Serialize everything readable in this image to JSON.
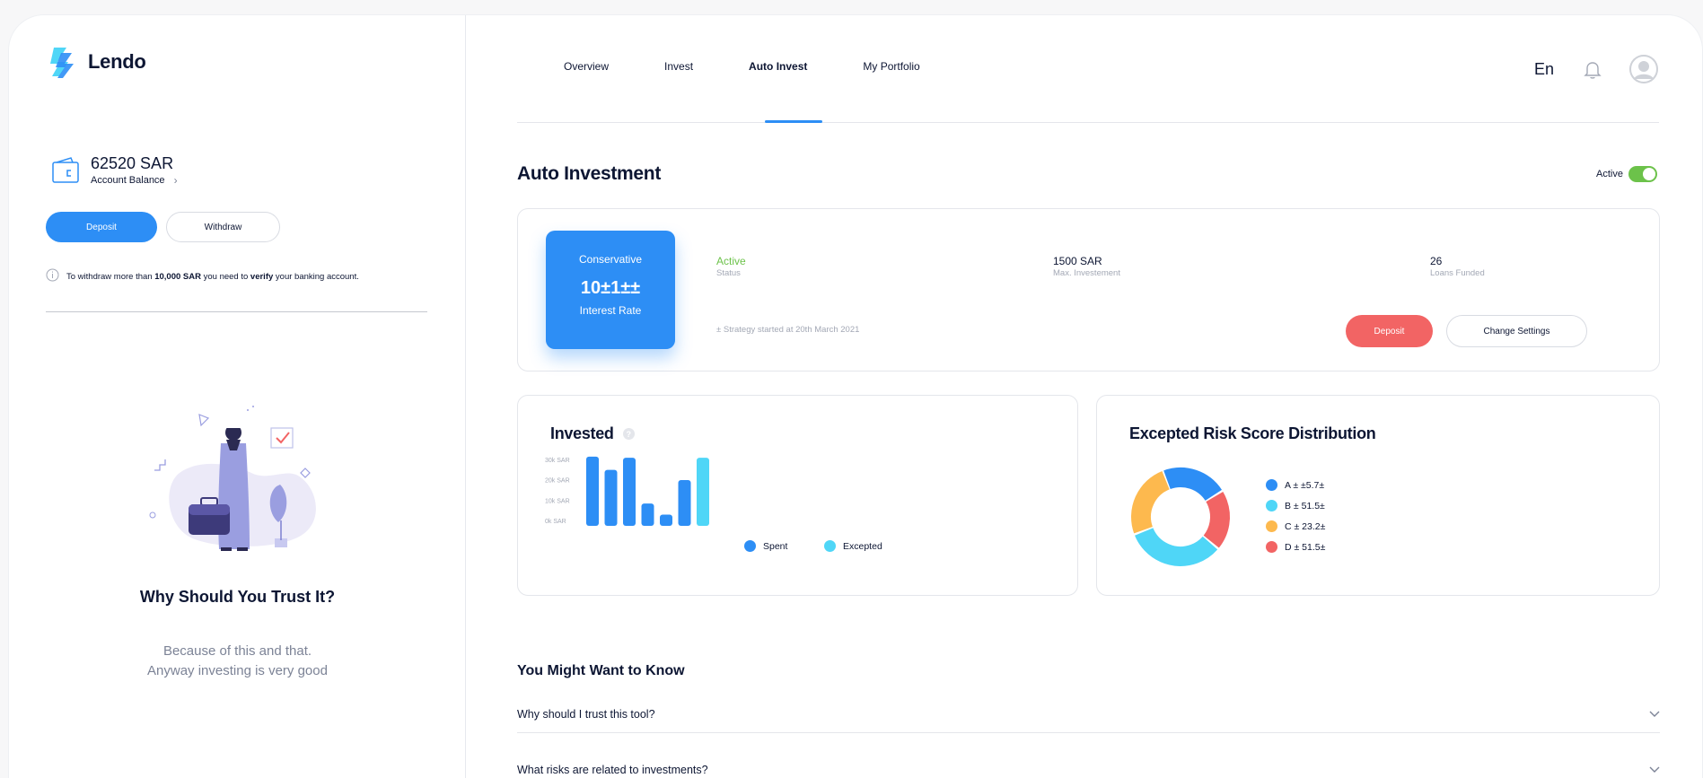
{
  "brand": {
    "name": "Lendo"
  },
  "account": {
    "balance": "62520 SAR",
    "balance_label": "Account Balance"
  },
  "actions": {
    "deposit": "Deposit",
    "withdraw": "Withdraw"
  },
  "notice": {
    "pre": "To withdraw more than ",
    "amount": "10,000 SAR",
    "mid": " you need to ",
    "verify": "verify",
    "post": " your banking account."
  },
  "trust": {
    "title": "Why Should You Trust It?",
    "line1": "Because of this and that.",
    "line2": "Anyway investing is very good"
  },
  "nav": {
    "items": [
      "Overview",
      "Invest",
      "Auto Invest",
      "My Portfolio"
    ],
    "active": "Auto Invest",
    "language": "En"
  },
  "auto": {
    "title": "Auto Investment",
    "toggle_label": "Active",
    "toggle_on": true,
    "strategy": {
      "name": "Conservative",
      "rate": "10±1±±",
      "rate_label": "Interest Rate"
    },
    "stats": [
      {
        "value": "Active",
        "label": "Status"
      },
      {
        "value": "1500 SAR",
        "label": "Max. Investement"
      },
      {
        "value": "26",
        "label": "Loans Funded"
      }
    ],
    "note": "± Strategy started at 20th March 2021",
    "deposit": "Deposit",
    "change_settings": "Change Settings"
  },
  "invested": {
    "title": "Invested",
    "help": "?"
  },
  "chart_data": [
    {
      "type": "bar",
      "title": "Invested",
      "y_ticks": [
        "30k SAR",
        "20k SAR",
        "10k SAR",
        "0k SAR"
      ],
      "ylim": [
        0,
        30000
      ],
      "series": [
        {
          "name": "Spent",
          "color": "#2d8ef5",
          "values": [
            34000,
            27500,
            33500,
            11000,
            5500,
            22500
          ]
        },
        {
          "name": "Excepted",
          "color": "#4fd6f7",
          "values": [
            0,
            0,
            0,
            0,
            0,
            0,
            33500
          ]
        }
      ],
      "bars": [
        {
          "series": "Spent",
          "value": 34000
        },
        {
          "series": "Spent",
          "value": 27500
        },
        {
          "series": "Spent",
          "value": 33500
        },
        {
          "series": "Spent",
          "value": 11000
        },
        {
          "series": "Spent",
          "value": 5500
        },
        {
          "series": "Spent",
          "value": 22500
        },
        {
          "series": "Excepted",
          "value": 33500
        }
      ],
      "legend": [
        "Spent",
        "Excepted"
      ]
    },
    {
      "type": "pie",
      "title": "Excepted Risk Score Distribution",
      "slices": [
        {
          "label": "A ± ±5.7±",
          "value": 22,
          "color": "#2d8ef5"
        },
        {
          "label": "D ± 51.5±",
          "value": 20,
          "color": "#f26464"
        },
        {
          "label": "B ± 51.5±",
          "value": 33,
          "color": "#4fd6f7"
        },
        {
          "label": "C ± 23.2±",
          "value": 25,
          "color": "#fdb94e"
        }
      ]
    }
  ],
  "risk": {
    "title": "Excepted Risk Score Distribution",
    "legend": [
      {
        "label": "A ± ±5.7±",
        "color": "#2d8ef5"
      },
      {
        "label": "B ± 51.5±",
        "color": "#4fd6f7"
      },
      {
        "label": "C ± 23.2±",
        "color": "#fdb94e"
      },
      {
        "label": "D ± 51.5±",
        "color": "#f26464"
      }
    ]
  },
  "faq": {
    "title": "You Might Want to Know",
    "items": [
      "Why should I trust this tool?",
      "What risks are related to investments?"
    ]
  },
  "icons": {
    "wallet": "wallet-icon",
    "info": "info-icon",
    "bell": "bell-icon",
    "avatar": "avatar-icon",
    "chevron": "chevron-down-icon"
  }
}
